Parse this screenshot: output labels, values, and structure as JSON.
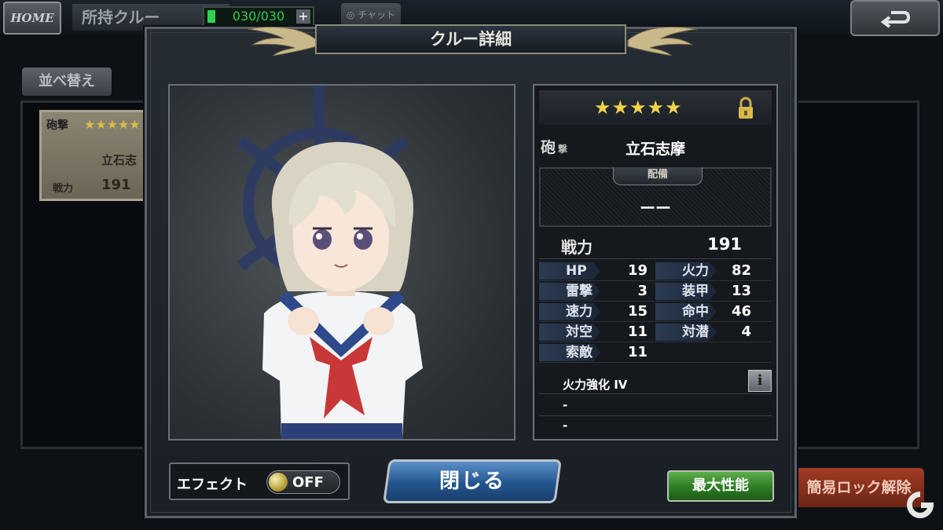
{
  "background": {
    "home_label": "HOME",
    "title": "所持クルー",
    "crew_count": "030/030",
    "chat_label": "チャット",
    "sort_label": "並べ替え",
    "card": {
      "type": "砲撃",
      "stars": "★★★★★",
      "name": "立石志",
      "power_label": "戦力",
      "power_value": "191"
    },
    "lock_release_label": "簡易ロック解除"
  },
  "dialog": {
    "title": "クルー詳細",
    "crew": {
      "rarity_stars": "★★★★★",
      "rarity": 5,
      "type_main": "砲",
      "type_sub": "撃",
      "name": "立石志摩",
      "locked": true
    },
    "equipment": {
      "label": "配備",
      "value": "ーー"
    },
    "power": {
      "label": "戦力",
      "value": "191"
    },
    "stats": [
      {
        "label": "HP",
        "value": "19",
        "label2": "火力",
        "value2": "82"
      },
      {
        "label": "雷撃",
        "value": "3",
        "label2": "装甲",
        "value2": "13"
      },
      {
        "label": "速力",
        "value": "15",
        "label2": "命中",
        "value2": "46"
      },
      {
        "label": "対空",
        "value": "11",
        "label2": "対潜",
        "value2": "4"
      },
      {
        "label": "索敵",
        "value": "11",
        "label2": "",
        "value2": ""
      }
    ],
    "skills": [
      "火力強化 IV",
      "-",
      "-"
    ],
    "info_label": "i",
    "effect": {
      "label": "エフェクト",
      "state": "OFF"
    },
    "close_label": "閉じる",
    "max_performance_label": "最大性能"
  },
  "colors": {
    "star": "#f2d34a",
    "close_button": "#24558f",
    "max_button": "#2c7b24",
    "count_green": "#2fd152"
  }
}
